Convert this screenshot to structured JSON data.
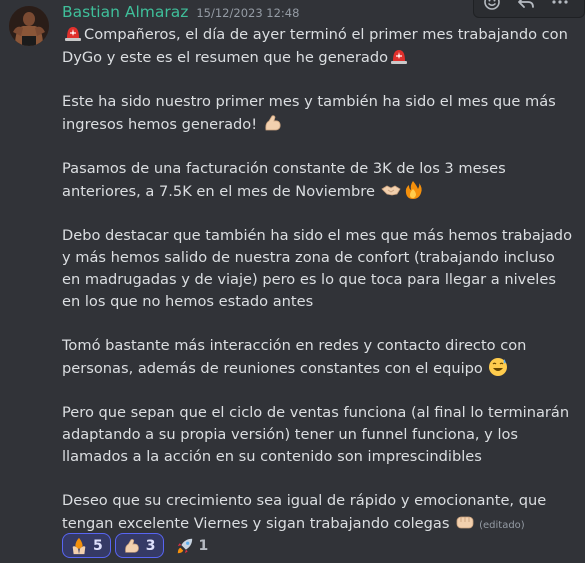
{
  "message": {
    "author": "Bastian Almaraz",
    "timestamp": "15/12/2023 12:48",
    "edited_label": "(editado)",
    "paragraphs": {
      "p1_a": "Compañeros, el día de ayer terminó el primer mes trabajando con DyGo y este es el resumen que he generado",
      "p2": "Este ha sido nuestro primer mes y también ha sido el mes que más ingresos hemos generado!",
      "p3": "Pasamos de una facturación constante de 3K de los 3 meses anteriores, a 7.5K en el mes de Noviembre",
      "p4": "Debo destacar que también ha sido el mes que más hemos trabajado y más hemos salido de nuestra zona de confort (trabajando incluso en madrugadas y de viaje) pero es lo que toca para llegar a niveles en los que no hemos estado antes",
      "p5": "Tomó bastante más interacción en redes y contacto directo con personas, además de reuniones constantes con el equipo",
      "p6": "Pero que sepan que el ciclo de ventas funciona (al final lo terminarán adaptando a su propia versión) tener un funnel funciona, y los llamados a la acción en su contenido son imprescindibles",
      "p7": "Deseo que su crecimiento sea igual de rápido y emocionante, que tengan excelente Viernes y sigan trabajando colegas"
    }
  },
  "reactions": [
    {
      "emoji": "fire-hands-icon",
      "count": "5"
    },
    {
      "emoji": "flexed-biceps-icon",
      "count": "3"
    },
    {
      "emoji": "rocket-icon",
      "count": "1"
    }
  ],
  "colors": {
    "background": "#313338",
    "username": "#3fbf9a",
    "text": "#dbdee1",
    "reaction_active": "#5865f2"
  }
}
